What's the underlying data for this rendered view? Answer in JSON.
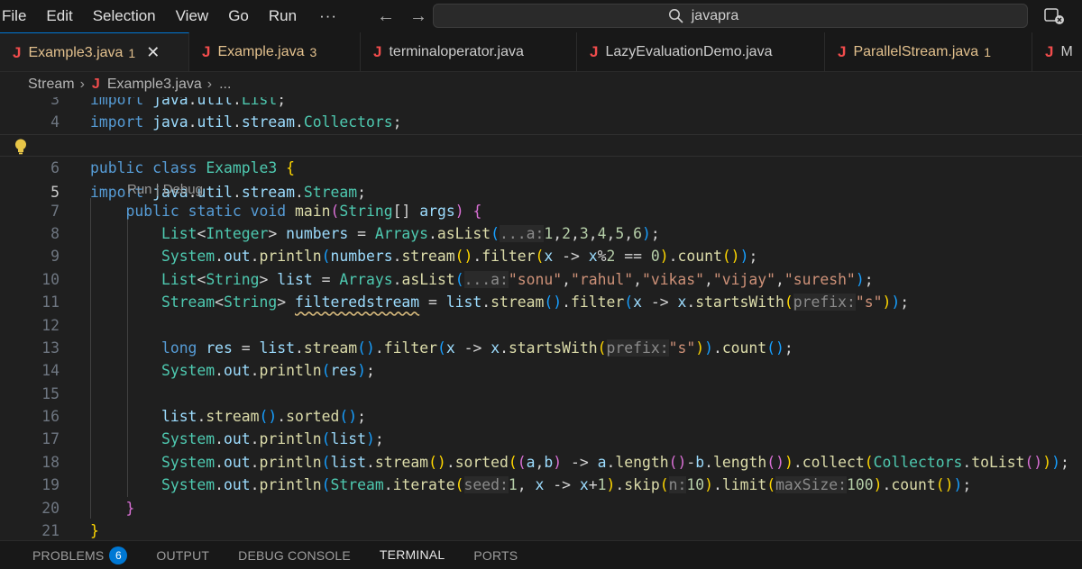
{
  "menu": {
    "items": [
      "File",
      "Edit",
      "Selection",
      "View",
      "Go",
      "Run"
    ],
    "more": "···"
  },
  "search": {
    "text": "javapra"
  },
  "tabs": [
    {
      "label": "Example3.java",
      "count": "1",
      "active": true,
      "warn": true
    },
    {
      "label": "Example.java",
      "count": "3",
      "active": false,
      "warn": true
    },
    {
      "label": "terminaloperator.java",
      "count": "",
      "active": false,
      "warn": false
    },
    {
      "label": "LazyEvaluationDemo.java",
      "count": "",
      "active": false,
      "warn": false
    },
    {
      "label": "ParallelStream.java",
      "count": "1",
      "active": false,
      "warn": true
    },
    {
      "label": "M",
      "count": "",
      "active": false,
      "warn": false
    }
  ],
  "breadcrumb": {
    "folder": "Stream",
    "file": "Example3.java",
    "more": "..."
  },
  "codelens": "Run | Debug",
  "code": {
    "l3": "import java.util.List;",
    "l4": "import java.util.stream.Collectors;",
    "l5": "import java.util.stream.Stream;",
    "l6": "public class Example3 {",
    "l7": "public static void main(String[] args) {",
    "l8": "List<Integer> numbers = Arrays.asList(...a:1,2,3,4,5,6);",
    "l9": "System.out.println(numbers.stream().filter(x -> x%2 == 0).count());",
    "l10": "List<String> list = Arrays.asList(...a:\"sonu\",\"rahul\",\"vikas\",\"vijay\",\"suresh\");",
    "l11": "Stream<String> filteredstream = list.stream().filter(x -> x.startsWith(prefix:\"s\"));",
    "l13": "long res = list.stream().filter(x -> x.startsWith(prefix:\"s\")).count();",
    "l14": "System.out.println(res);",
    "l16": "list.stream().sorted();",
    "l17": "System.out.println(list);",
    "l18": "System.out.println(list.stream().sorted((a,b) -> a.length()-b.length()).collect(Collectors.toList()));",
    "l19": "System.out.println(Stream.iterate(seed:1, x -> x+1).skip(n:10).limit(maxSize:100).count());",
    "l20": "}",
    "l21": "}"
  },
  "line_numbers": [
    "3",
    "4",
    "5",
    "6",
    "7",
    "8",
    "9",
    "10",
    "11",
    "12",
    "13",
    "14",
    "15",
    "16",
    "17",
    "18",
    "19",
    "20",
    "21"
  ],
  "panel": {
    "tabs": [
      "PROBLEMS",
      "OUTPUT",
      "DEBUG CONSOLE",
      "TERMINAL",
      "PORTS"
    ],
    "problems_count": "6",
    "active": "TERMINAL"
  },
  "colors": {
    "keyword": "#569cd6",
    "type": "#4ec9b0",
    "method": "#dcdcaa",
    "variable": "#9cdcfe",
    "string": "#ce9178",
    "number": "#b5cea8",
    "error_j": "#f14c4c",
    "warning": "#e2c08d",
    "accent": "#0078d4"
  }
}
